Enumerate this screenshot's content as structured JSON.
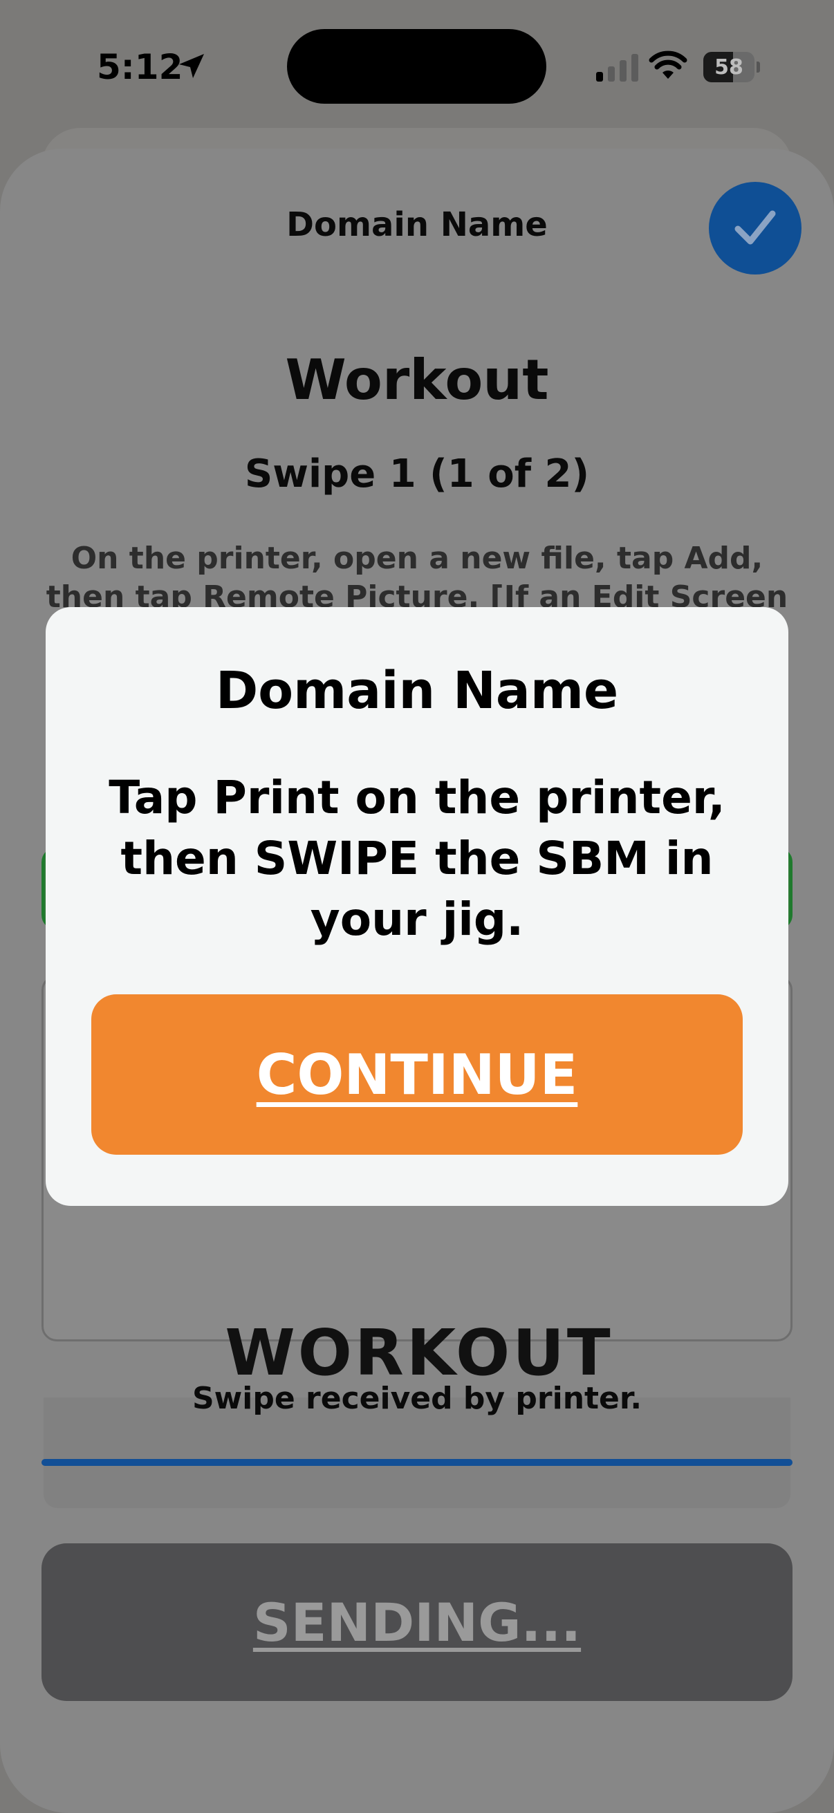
{
  "status_bar": {
    "time": "5:12",
    "battery_level": "58",
    "icons": [
      "location-arrow-icon",
      "cellular-signal-icon",
      "wifi-icon",
      "battery-icon"
    ]
  },
  "sheet": {
    "title": "Domain Name",
    "heading": "Workout",
    "subheading": "Swipe 1 (1 of 2)",
    "instructions": "On the printer, open a new file, tap Add, then tap Remote Picture. [If an Edit Screen is",
    "preview_label": "WORKOUT",
    "swipe_status": "Swipe received by printer.",
    "progress": 1.0,
    "faded_text": "",
    "sending_label": "SENDING...",
    "accent_color": "#0f4f95"
  },
  "alert": {
    "title": "Domain Name",
    "message": "Tap Print on the printer, then SWIPE the SBM in your jig.",
    "continue_label": "CONTINUE",
    "button_color": "#f1872f"
  }
}
